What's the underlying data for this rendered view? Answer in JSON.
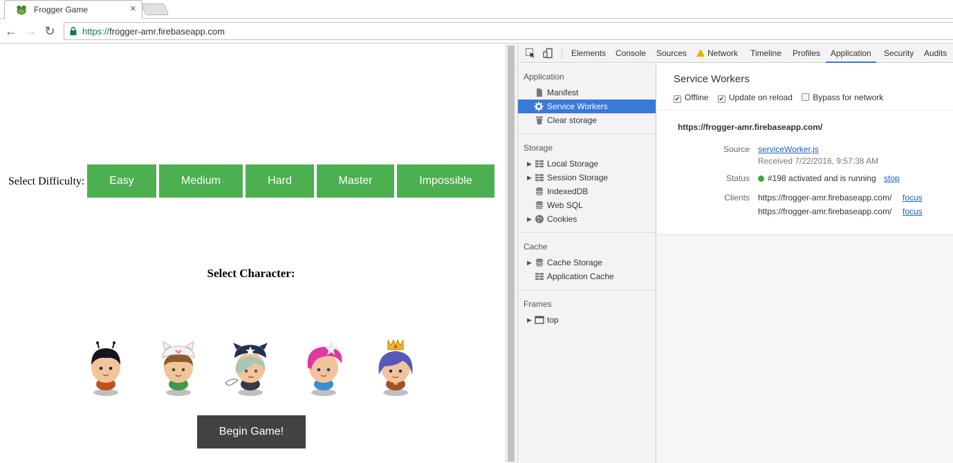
{
  "browser": {
    "tab": {
      "title": "Frogger Game",
      "close": "×"
    },
    "nav": {
      "back": "←",
      "forward": "→",
      "reload": "↻"
    },
    "url": {
      "scheme": "https://",
      "host": "frogger-amr.firebaseapp.com"
    }
  },
  "game": {
    "difficulty_label": "Select Difficulty:",
    "difficulties": [
      "Easy",
      "Medium",
      "Hard",
      "Master",
      "Impossible"
    ],
    "difficulty_color": "#4caf50",
    "character_heading": "Select Character:",
    "characters": [
      "boy-character",
      "cat-girl-character",
      "horn-girl-character",
      "pink-girl-character",
      "princess-character"
    ],
    "begin_label": "Begin Game!"
  },
  "devtools": {
    "tabs": [
      "Elements",
      "Console",
      "Sources",
      "Network",
      "Timeline",
      "Profiles",
      "Application",
      "Security",
      "Audits"
    ],
    "active_tab": "Application",
    "sidebar": {
      "application_header": "Application",
      "application_items": [
        "Manifest",
        "Service Workers",
        "Clear storage"
      ],
      "selected_item": "Service Workers",
      "storage_header": "Storage",
      "storage_items": [
        "Local Storage",
        "Session Storage",
        "IndexedDB",
        "Web SQL",
        "Cookies"
      ],
      "cache_header": "Cache",
      "cache_items": [
        "Cache Storage",
        "Application Cache"
      ],
      "frames_header": "Frames",
      "frames_items": [
        "top"
      ]
    },
    "service_workers": {
      "title": "Service Workers",
      "options": {
        "offline": {
          "label": "Offline",
          "checked": true
        },
        "update_on_reload": {
          "label": "Update on reload",
          "checked": true
        },
        "bypass_for_network": {
          "label": "Bypass for network",
          "checked": false
        }
      },
      "scope": "https://frogger-amr.firebaseapp.com/",
      "source_label": "Source",
      "source_file": "serviceWorker.js",
      "received": "Received 7/22/2016, 9:57:38 AM",
      "status_label": "Status",
      "status_text": "#198 activated and is running",
      "status_action": "stop",
      "clients_label": "Clients",
      "clients": [
        {
          "url": "https://frogger-amr.firebaseapp.com/",
          "action": "focus"
        },
        {
          "url": "https://frogger-amr.firebaseapp.com/",
          "action": "focus"
        }
      ]
    }
  }
}
